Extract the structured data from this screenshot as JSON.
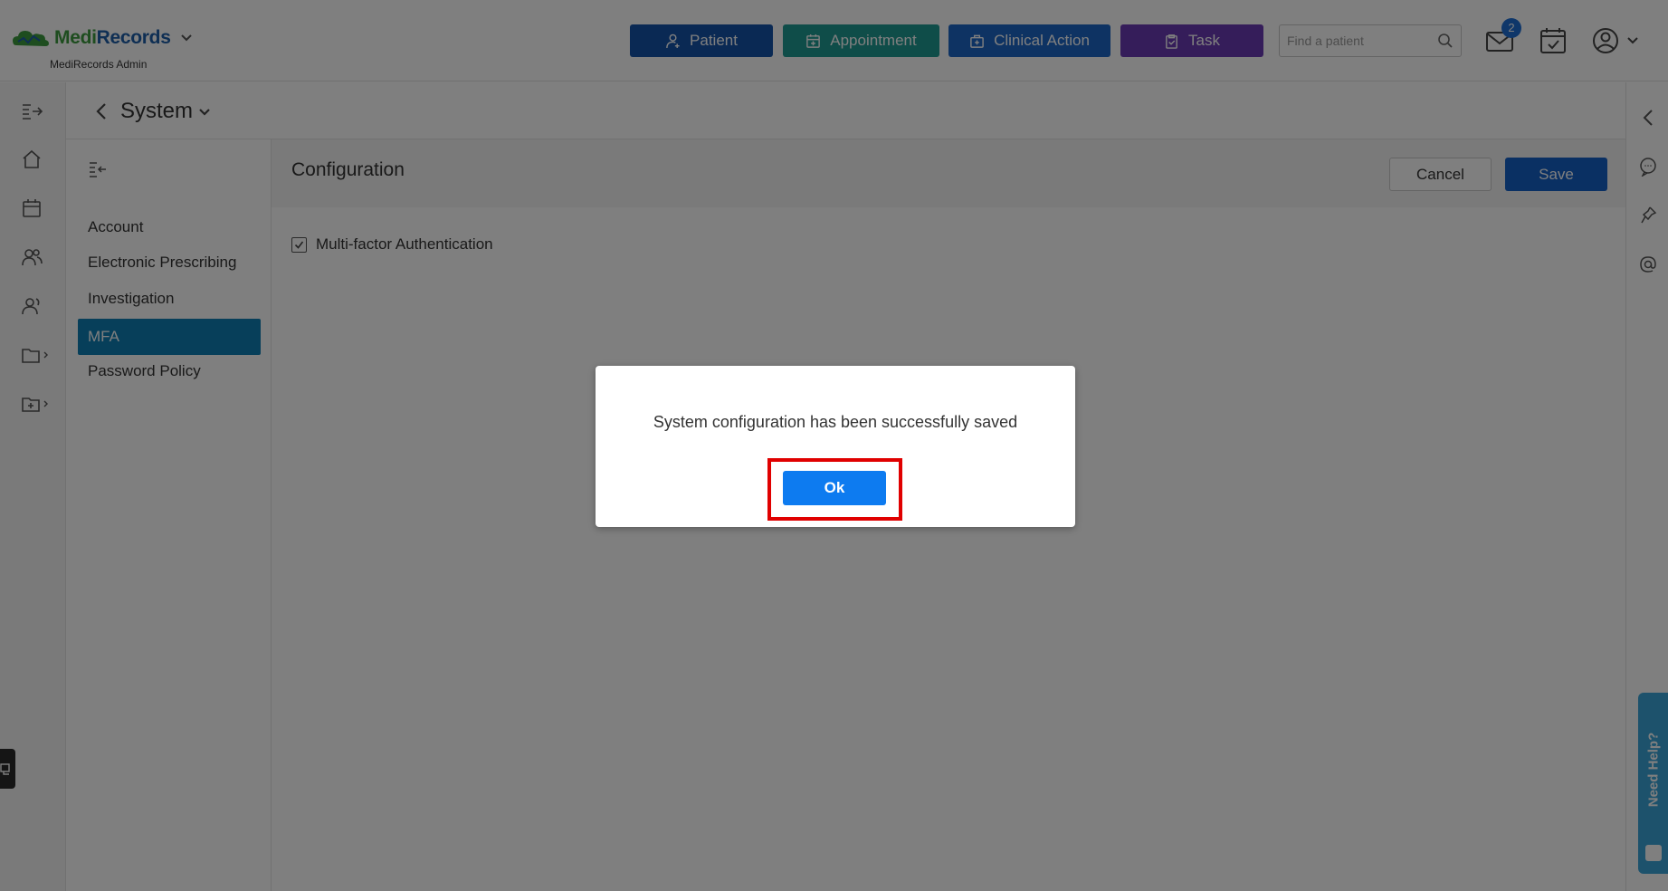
{
  "header": {
    "brand_part1": "Medi",
    "brand_part2": "Records",
    "brand_sub": "MediRecords Admin",
    "nav": {
      "patient": "Patient",
      "appointment": "Appointment",
      "clinical_action": "Clinical Action",
      "task": "Task"
    },
    "search_placeholder": "Find a patient",
    "mail_badge": "2"
  },
  "titlebar": {
    "title": "System"
  },
  "subnav": {
    "items": [
      {
        "label": "Account"
      },
      {
        "label": "Electronic Prescribing"
      },
      {
        "label": "Investigation"
      },
      {
        "label": "MFA"
      },
      {
        "label": "Password Policy"
      }
    ],
    "active": "MFA"
  },
  "content": {
    "title": "Configuration",
    "cancel_label": "Cancel",
    "save_label": "Save",
    "mfa_label": "Multi-factor Authentication",
    "mfa_checked": true
  },
  "help_tab": {
    "label": "Need Help?"
  },
  "dialog": {
    "message": "System configuration has been successfully saved",
    "ok_label": "Ok"
  },
  "colors": {
    "patient": "#1552a8",
    "appointment": "#1f9a93",
    "clinical_action": "#1c66c6",
    "task": "#6b3ab5",
    "active_subnav": "#0e7fb5",
    "save": "#1460c6",
    "ok": "#0d7bf0",
    "highlight": "#e00000"
  }
}
